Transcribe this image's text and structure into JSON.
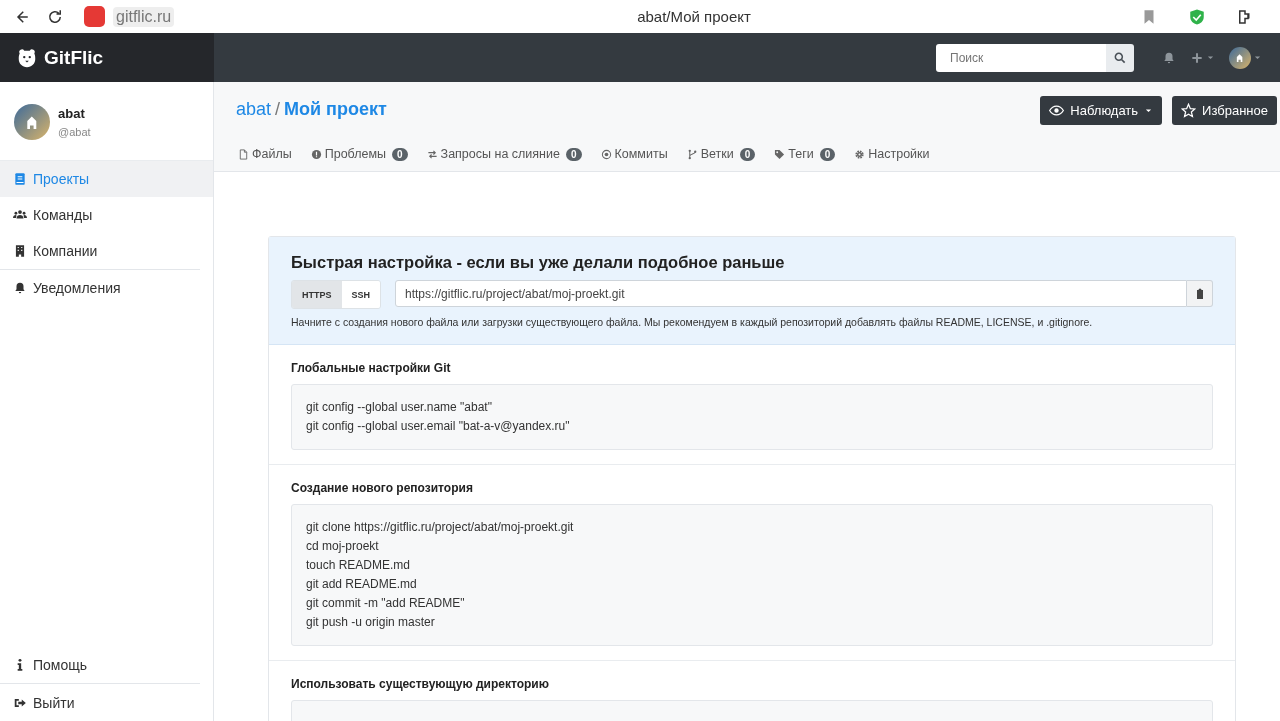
{
  "browser": {
    "domain": "gitflic.ru",
    "title": "abat/Мой проект"
  },
  "header": {
    "brand": "GitFlic",
    "search": {
      "placeholder": "Поиск"
    }
  },
  "profile": {
    "name": "abat",
    "handle": "@abat"
  },
  "sidebar": {
    "items": [
      {
        "label": "Проекты",
        "selected": true
      },
      {
        "label": "Команды",
        "selected": false
      },
      {
        "label": "Компании",
        "selected": false
      },
      {
        "label": "Уведомления",
        "selected": false
      }
    ],
    "footer_items": [
      {
        "label": "Помощь"
      },
      {
        "label": "Выйти"
      }
    ]
  },
  "project": {
    "owner": "abat",
    "separator": "/",
    "name": "Мой проект",
    "buttons": [
      {
        "label": "Наблюдать"
      },
      {
        "label": "Избранное"
      }
    ],
    "tabs": [
      {
        "label": "Файлы"
      },
      {
        "label": "Проблемы",
        "count": "0"
      },
      {
        "label": "Запросы на слияние",
        "count": "0"
      },
      {
        "label": "Коммиты"
      },
      {
        "label": "Ветки",
        "count": "0"
      },
      {
        "label": "Теги",
        "count": "0"
      },
      {
        "label": "Настройки"
      }
    ]
  },
  "quick_setup": {
    "title": "Быстрая настройка - если вы уже делали подобное раньше",
    "protocols": [
      {
        "label": "HTTPS",
        "selected": true
      },
      {
        "label": "SSH",
        "selected": false
      }
    ],
    "url": "https://gitflic.ru/project/abat/moj-proekt.git",
    "hint": "Начните с создания нового файла или загрузки существующего файла. Мы рекомендуем в каждый репозиторий добавлять файлы README, LICENSE, и .gitignore."
  },
  "sections": [
    {
      "title": "Глобальные настройки Git",
      "code": [
        "git config --global user.name \"abat\"",
        "git config --global user.email \"bat-a-v@yandex.ru\""
      ]
    },
    {
      "title": "Создание нового репозитория",
      "code": [
        "git clone https://gitflic.ru/project/abat/moj-proekt.git",
        "cd moj-proekt",
        "touch README.md",
        "git add README.md",
        "git commit -m \"add README\"",
        "git push -u origin master"
      ]
    },
    {
      "title": "Использовать существующую директорию"
    }
  ]
}
